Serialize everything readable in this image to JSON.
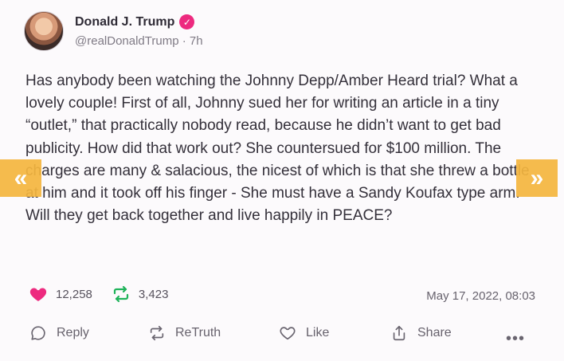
{
  "post": {
    "author": {
      "display_name": "Donald J. Trump",
      "handle_line": "@realDonaldTrump · 7h",
      "verified_icon": "verified-check-icon"
    },
    "text": "Has anybody been watching the Johnny Depp/Amber Heard trial? What a lovely couple! First of all, Johnny sued her for writing an article in a tiny “outlet,” that practically nobody read, because he didn’t want to get bad publicity. How did that work out? She countersued for $100 million. The charges are many & salacious, the nicest of which is that she threw a bottle at him and it took off his finger - She must have a Sandy Koufax type arm. Will they get back together and live happily in PEACE?",
    "stats": {
      "likes": "12,258",
      "retruths": "3,423"
    },
    "timestamp": "May 17, 2022, 08:03"
  },
  "actions": {
    "reply": "Reply",
    "retruth": "ReTruth",
    "like": "Like",
    "share": "Share",
    "more": "•••"
  },
  "nav": {
    "prev": "«",
    "next": "»"
  },
  "colors": {
    "accent_pink": "#ed2a7f",
    "nav_orange": "#f5b63f",
    "retruth_green": "#1fb35a"
  }
}
